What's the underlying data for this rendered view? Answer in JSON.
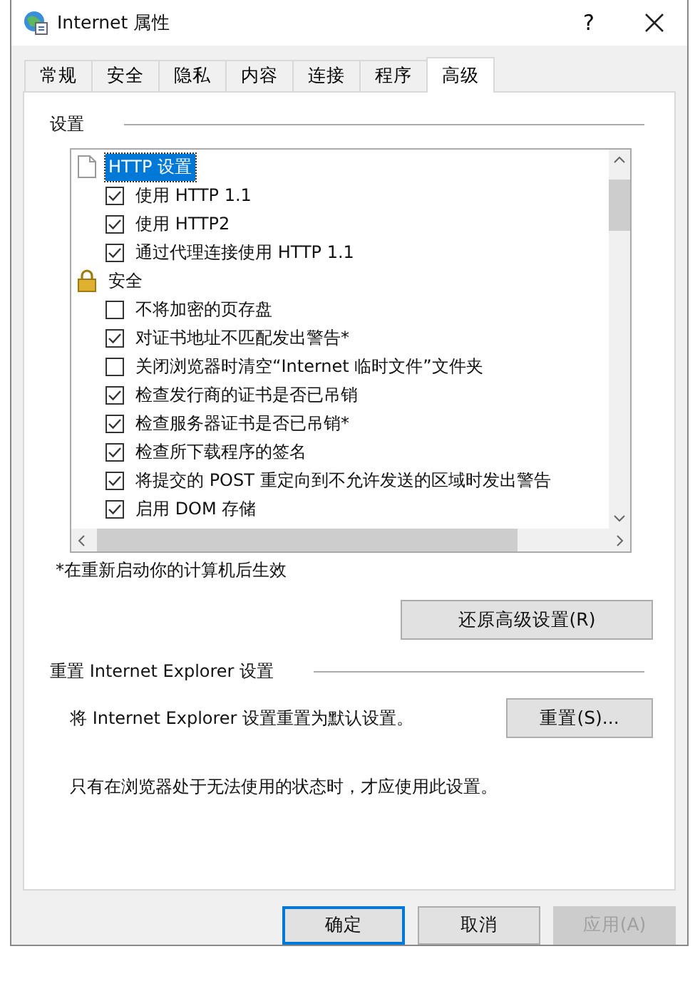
{
  "window": {
    "title": "Internet 属性",
    "help": "?"
  },
  "tabs": [
    {
      "label": "常规",
      "selected": false
    },
    {
      "label": "安全",
      "selected": false
    },
    {
      "label": "隐私",
      "selected": false
    },
    {
      "label": "内容",
      "selected": false
    },
    {
      "label": "连接",
      "selected": false
    },
    {
      "label": "程序",
      "selected": false
    },
    {
      "label": "高级",
      "selected": true
    }
  ],
  "settings": {
    "title": "设置",
    "groups": [
      {
        "label": "HTTP 设置",
        "selected": true,
        "children": [
          {
            "label": "使用 HTTP 1.1",
            "checked": true
          },
          {
            "label": "使用 HTTP2",
            "checked": true
          },
          {
            "label": "通过代理连接使用 HTTP 1.1",
            "checked": true
          }
        ]
      },
      {
        "label": "安全",
        "selected": false,
        "children": [
          {
            "label": "不将加密的页存盘",
            "checked": false
          },
          {
            "label": "对证书地址不匹配发出警告*",
            "checked": true
          },
          {
            "label": "关闭浏览器时清空“Internet 临时文件”文件夹",
            "checked": false
          },
          {
            "label": "检查发行商的证书是否已吊销",
            "checked": true
          },
          {
            "label": "检查服务器证书是否已吊销*",
            "checked": true
          },
          {
            "label": "检查所下载程序的签名",
            "checked": true
          },
          {
            "label": "将提交的 POST 重定向到不允许发送的区域时发出警告",
            "checked": true
          },
          {
            "label": "启用 DOM 存储",
            "checked": true
          }
        ]
      }
    ],
    "footnote": "*在重新启动你的计算机后生效",
    "restore_button": "还原高级设置(R)"
  },
  "reset": {
    "title": "重置 Internet Explorer 设置",
    "description": "将 Internet Explorer 设置重置为默认设置。",
    "button": "重置(S)...",
    "note": "只有在浏览器处于无法使用的状态时，才应使用此设置。"
  },
  "buttons": [
    {
      "label": "确定",
      "default": true,
      "disabled": false
    },
    {
      "label": "取消",
      "default": false,
      "disabled": false
    },
    {
      "label": "应用(A)",
      "default": false,
      "disabled": true
    }
  ]
}
